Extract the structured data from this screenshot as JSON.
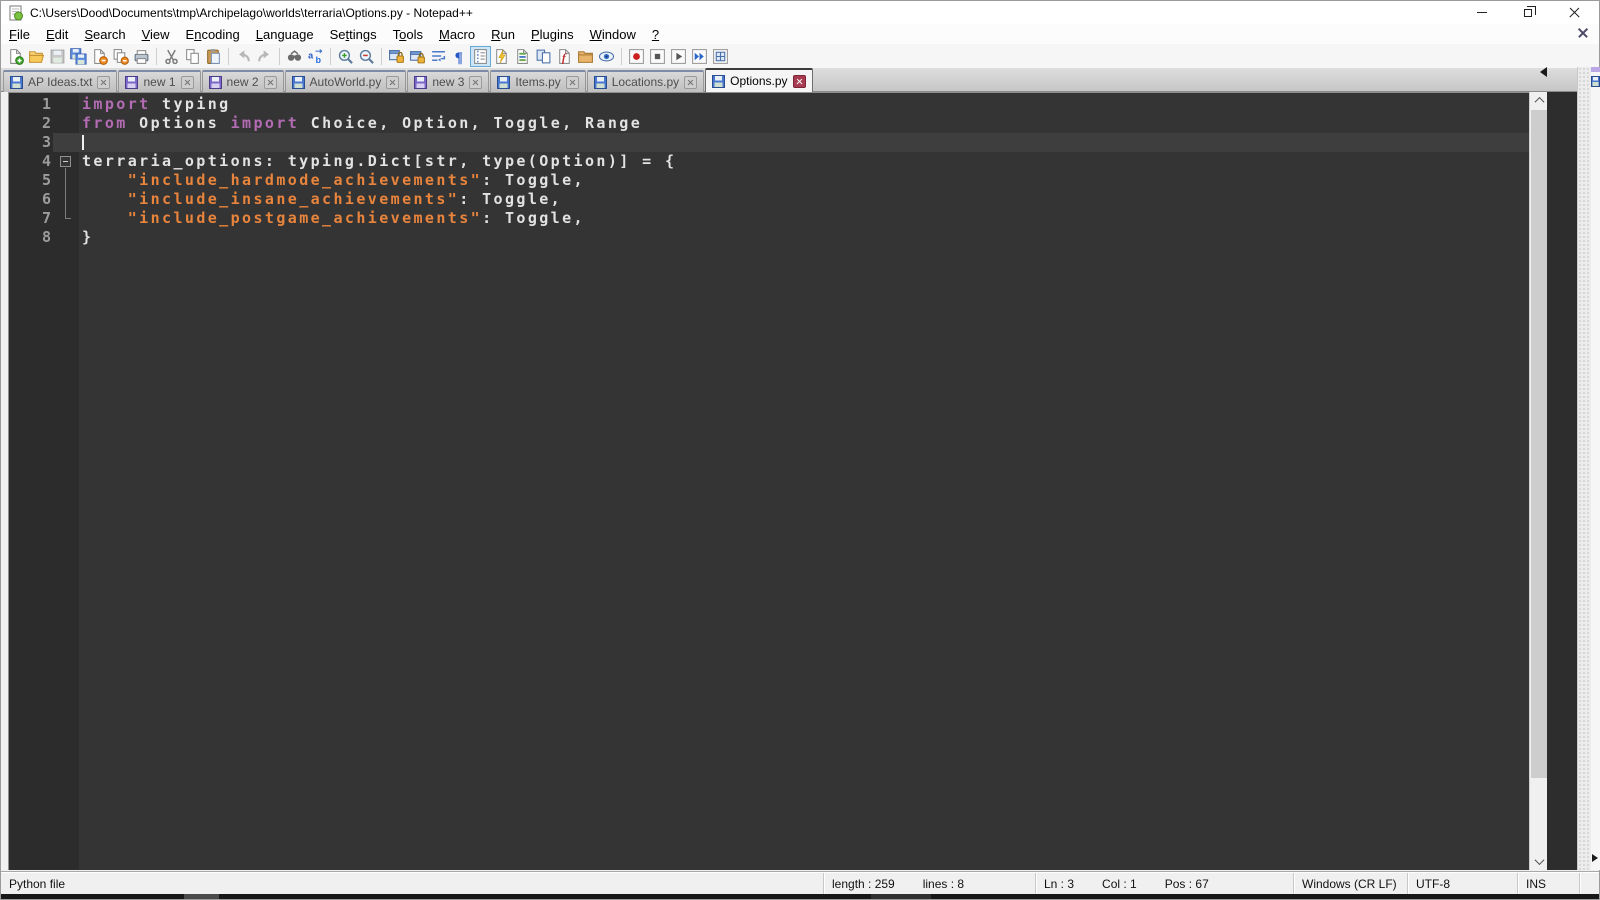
{
  "window": {
    "title": "C:\\Users\\Dood\\Documents\\tmp\\Archipelago\\worlds\\terraria\\Options.py - Notepad++"
  },
  "menu": {
    "items": [
      {
        "label": "File",
        "u": 0
      },
      {
        "label": "Edit",
        "u": 0
      },
      {
        "label": "Search",
        "u": 0
      },
      {
        "label": "View",
        "u": 0
      },
      {
        "label": "Encoding",
        "u": 1
      },
      {
        "label": "Language",
        "u": 0
      },
      {
        "label": "Settings",
        "u": 2
      },
      {
        "label": "Tools",
        "u": 1
      },
      {
        "label": "Macro",
        "u": 0
      },
      {
        "label": "Run",
        "u": 0
      },
      {
        "label": "Plugins",
        "u": 0
      },
      {
        "label": "Window",
        "u": 0
      },
      {
        "label": "?",
        "u": 0
      }
    ]
  },
  "toolbar": {
    "groups": [
      [
        "new-file",
        "open-folder",
        "save",
        "save-all",
        "close-file",
        "close-all",
        "print"
      ],
      [
        "cut",
        "copy",
        "paste"
      ],
      [
        "undo",
        "redo"
      ],
      [
        "find",
        "replace"
      ],
      [
        "zoom-in",
        "zoom-out"
      ],
      [
        "sync-vertical",
        "sync-horizontal",
        "word-wrap",
        "show-all-characters",
        "indent-guide",
        "doc-map",
        "document-list",
        "doc-switcher",
        "function-list",
        "folder-as-workspace",
        "monitoring"
      ],
      [
        "macro-record",
        "macro-stop",
        "macro-play",
        "macro-run-multiple",
        "macro-save"
      ]
    ],
    "disabled": [
      "save",
      "undo",
      "redo"
    ],
    "active": [
      "indent-guide"
    ]
  },
  "tabs": [
    {
      "label": "AP Ideas.txt",
      "state": "saved",
      "active": false
    },
    {
      "label": "new 1",
      "state": "modified",
      "active": false
    },
    {
      "label": "new 2",
      "state": "modified",
      "active": false
    },
    {
      "label": "AutoWorld.py",
      "state": "saved",
      "active": false
    },
    {
      "label": "new 3",
      "state": "modified",
      "active": false
    },
    {
      "label": "Items.py",
      "state": "saved",
      "active": false
    },
    {
      "label": "Locations.py",
      "state": "saved",
      "active": false
    },
    {
      "label": "Options.py",
      "state": "saved",
      "active": true
    }
  ],
  "editor": {
    "language_colors": {
      "keyword": "#b36cb3",
      "string": "#e8843c",
      "default": "#e2e2e2",
      "background": "#343434"
    },
    "lines": [
      {
        "n": "1",
        "fold": "",
        "cur": false,
        "segs": [
          [
            "import",
            "k"
          ],
          [
            " typing",
            "d"
          ]
        ]
      },
      {
        "n": "2",
        "fold": "",
        "cur": false,
        "segs": [
          [
            "from",
            "k"
          ],
          [
            " Options ",
            "d"
          ],
          [
            "import",
            "k"
          ],
          [
            " Choice, Option, Toggle, Range",
            "d"
          ]
        ]
      },
      {
        "n": "3",
        "fold": "",
        "cur": true,
        "segs": []
      },
      {
        "n": "4",
        "fold": "start",
        "cur": false,
        "segs": [
          [
            "terraria_options: typing.Dict[str, type(Option)] = {",
            "d"
          ]
        ]
      },
      {
        "n": "5",
        "fold": "mid",
        "cur": false,
        "segs": [
          [
            "    ",
            "d"
          ],
          [
            "\"include_hardmode_achievements\"",
            "s"
          ],
          [
            ": Toggle,",
            "d"
          ]
        ]
      },
      {
        "n": "6",
        "fold": "mid",
        "cur": false,
        "segs": [
          [
            "    ",
            "d"
          ],
          [
            "\"include_insane_achievements\"",
            "s"
          ],
          [
            ": Toggle,",
            "d"
          ]
        ]
      },
      {
        "n": "7",
        "fold": "end",
        "cur": false,
        "segs": [
          [
            "    ",
            "d"
          ],
          [
            "\"include_postgame_achievements\"",
            "s"
          ],
          [
            ": Toggle,",
            "d"
          ]
        ]
      },
      {
        "n": "8",
        "fold": "",
        "cur": false,
        "segs": [
          [
            "}",
            "d"
          ]
        ]
      }
    ]
  },
  "status": {
    "doc_type": "Python file",
    "length_label": "length : 259",
    "lines_label": "lines : 8",
    "line_label": "Ln : 3",
    "col_label": "Col : 1",
    "pos_label": "Pos : 67",
    "eol": "Windows (CR LF)",
    "encoding": "UTF-8",
    "insert_mode": "INS"
  }
}
